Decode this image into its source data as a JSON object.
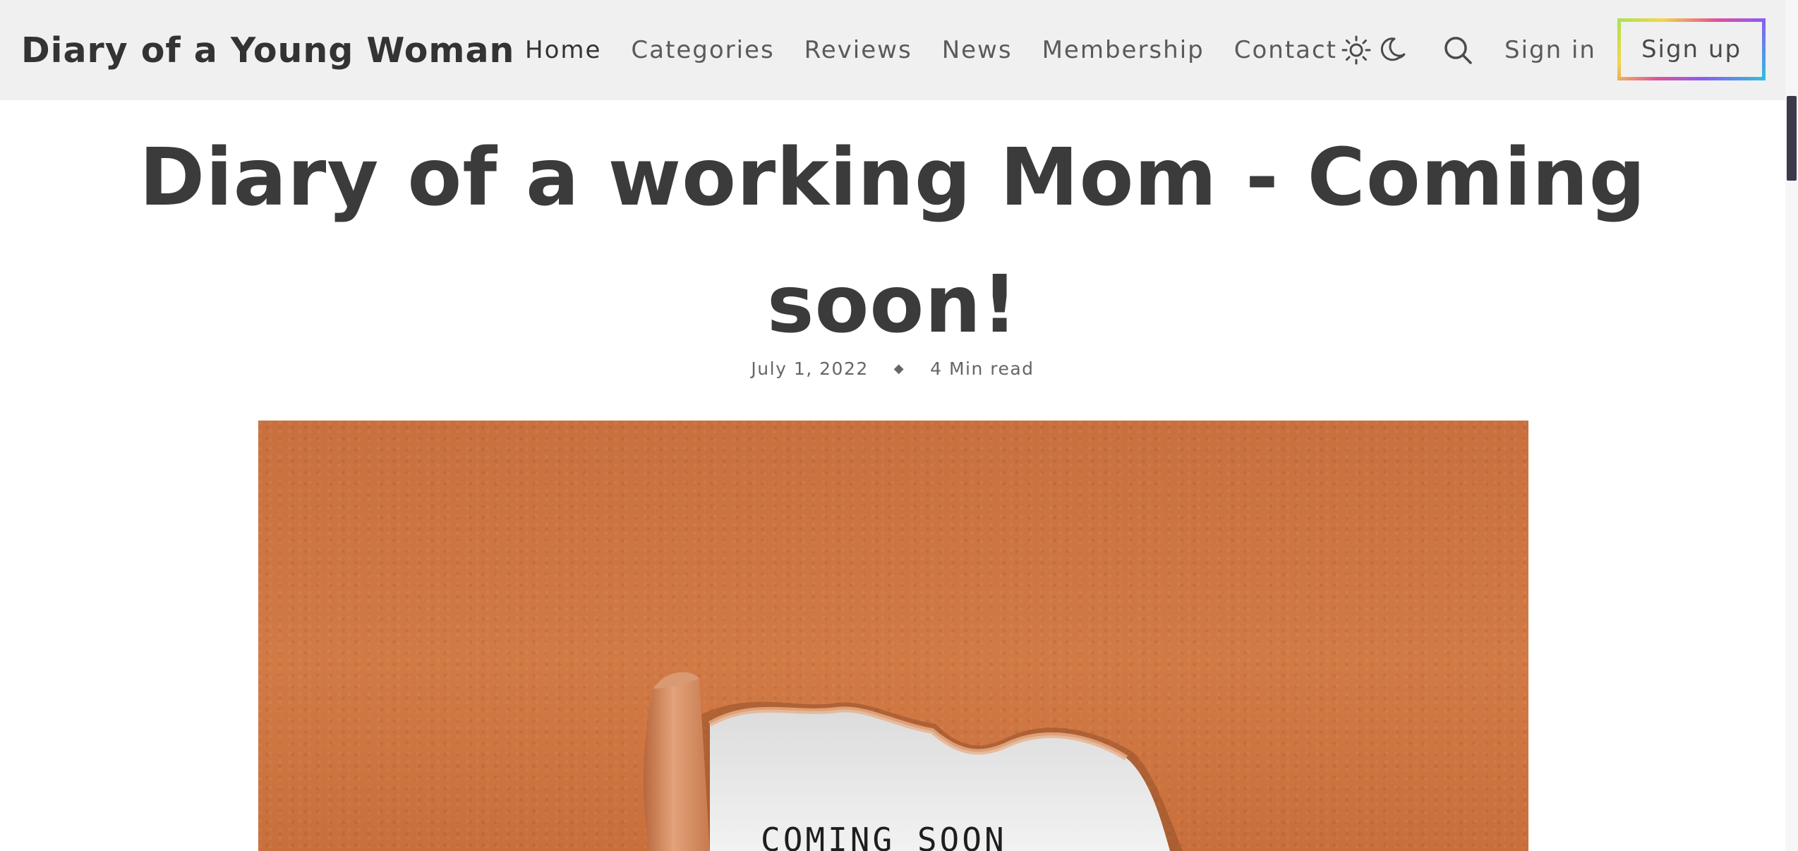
{
  "site": {
    "logo": "Diary of a Young Woman"
  },
  "nav": {
    "items": [
      "Home",
      "Categories",
      "Reviews",
      "News",
      "Membership",
      "Contact"
    ],
    "active": "Home"
  },
  "header_actions": {
    "theme_icons": [
      "sun-icon",
      "moon-icon"
    ],
    "search_icon": "search-icon",
    "signin_label": "Sign in",
    "signup_label": "Sign up",
    "signup_border_gradient": [
      "#a6e34e",
      "#f3d64a",
      "#e0509a",
      "#8a5cf6",
      "#2ac4d9"
    ]
  },
  "article": {
    "title": "Diary of a working Mom - Coming soon!",
    "date": "July 1, 2022",
    "separator": "◆",
    "read_time": "4 Min read"
  },
  "hero": {
    "text": "COMING SOON",
    "paper_color": "#cf7743"
  },
  "colors": {
    "header_bg": "#f0f0f0",
    "text_dark": "#3b3b3b",
    "text_muted": "#666666"
  }
}
